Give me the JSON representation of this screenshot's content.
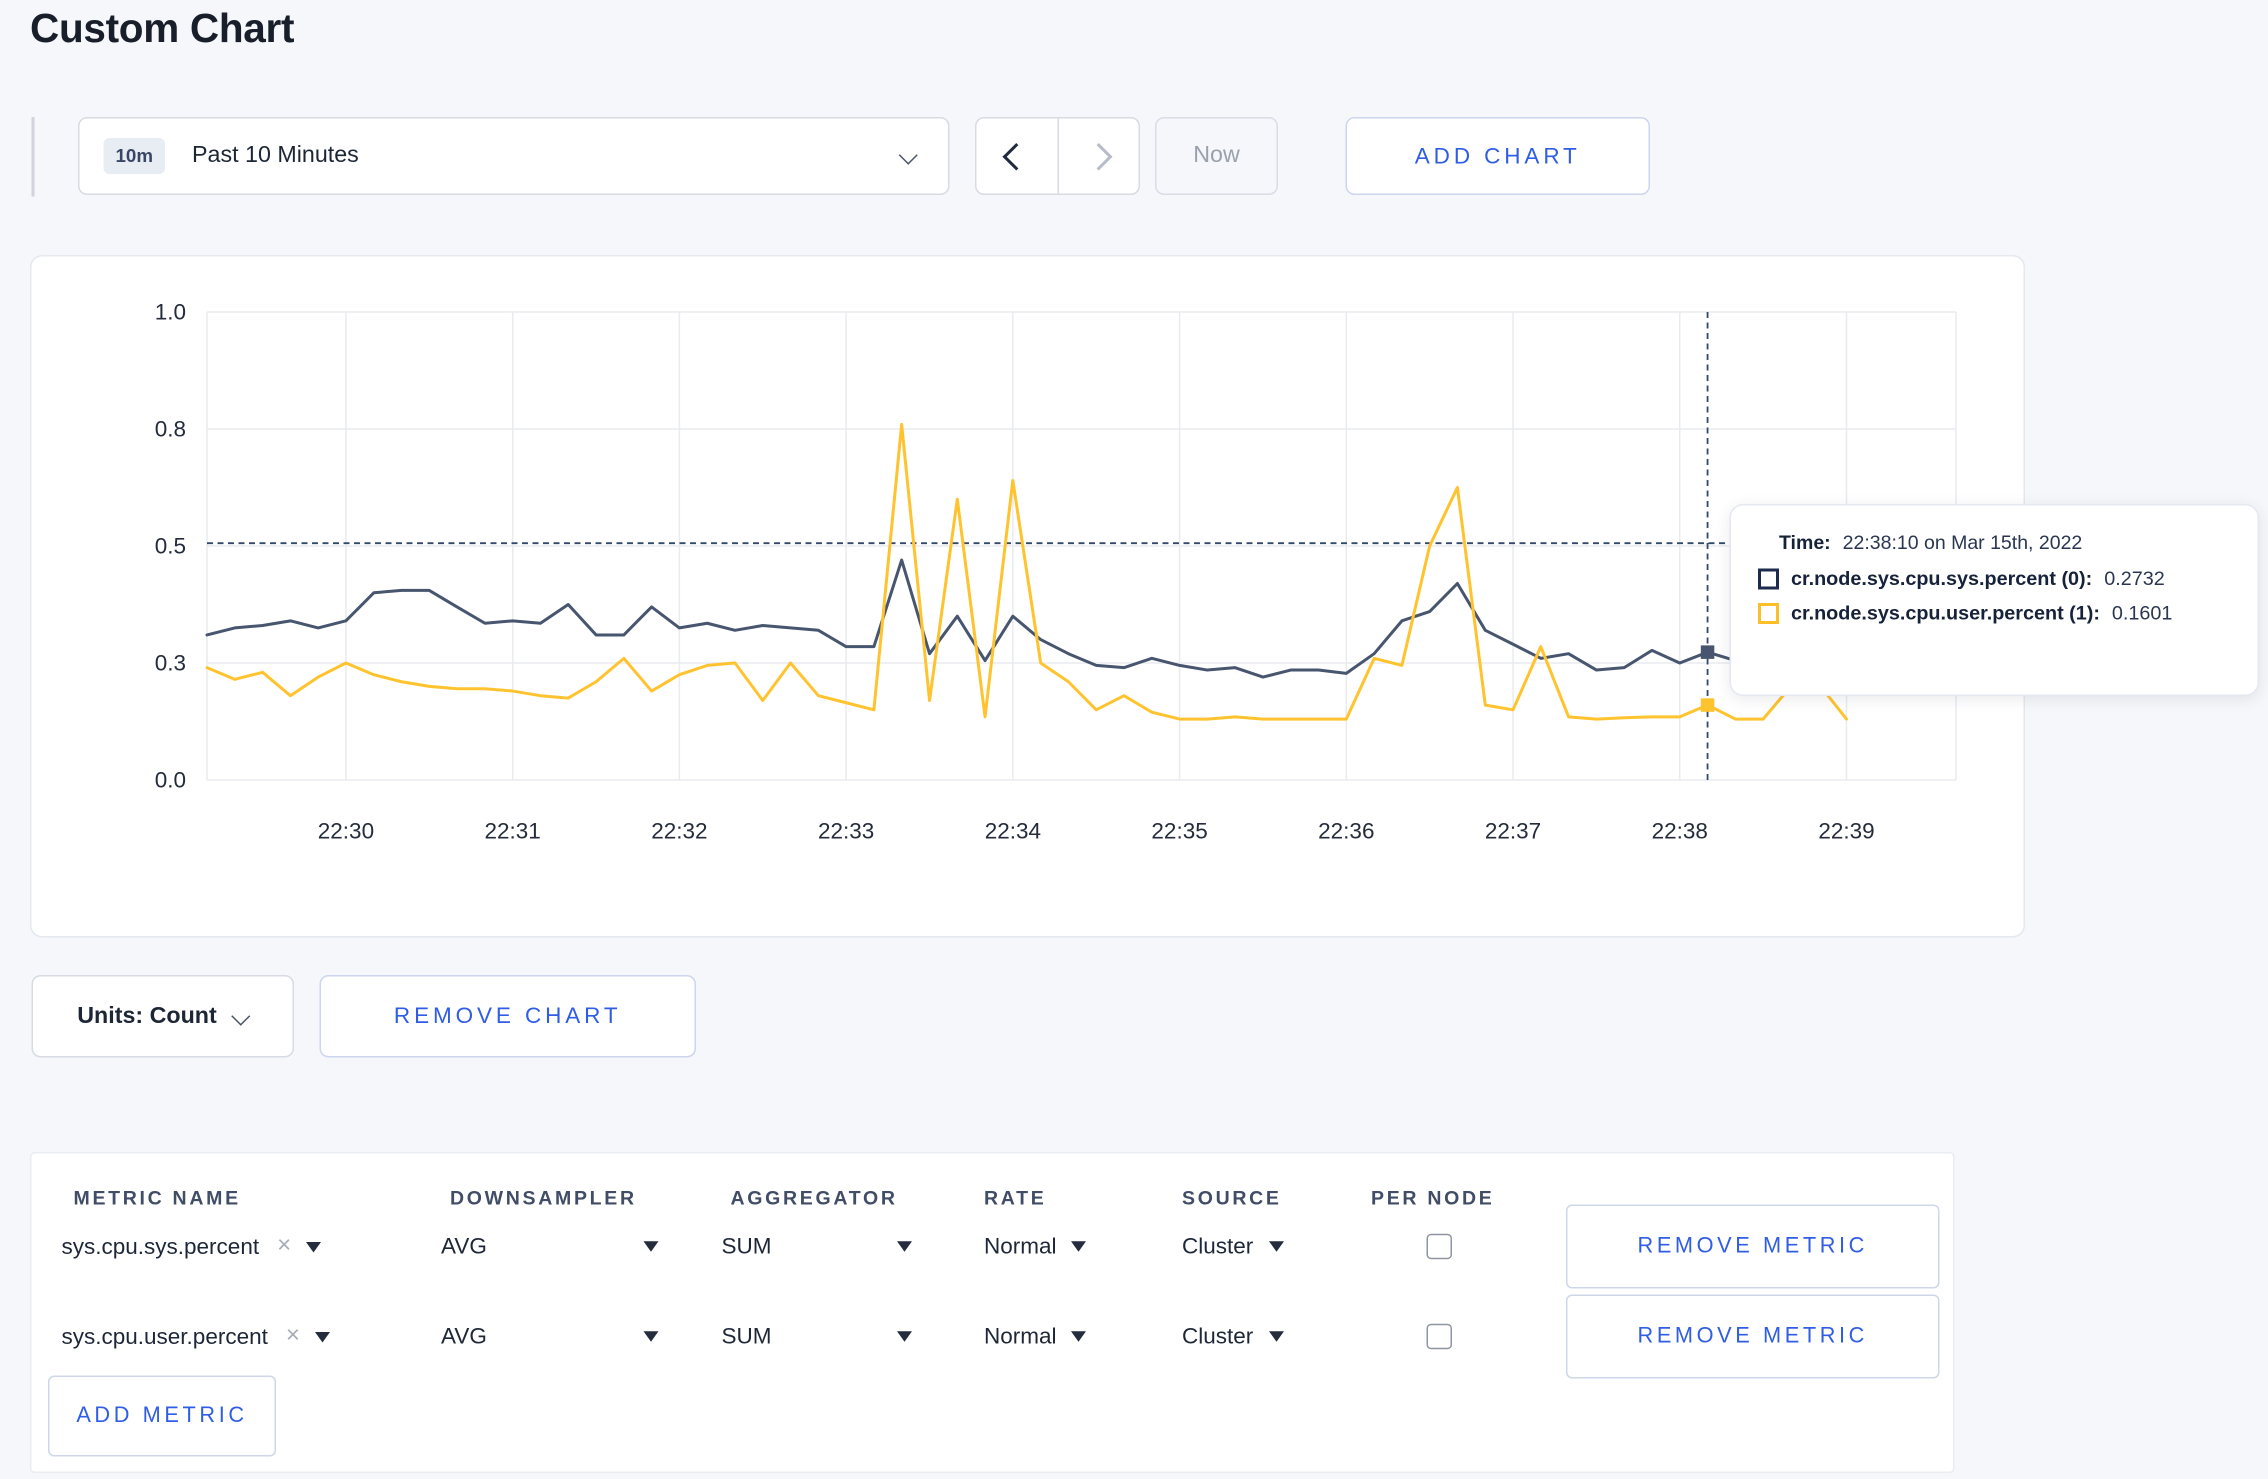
{
  "page": {
    "title": "Custom Chart"
  },
  "toolbar": {
    "time_range_badge": "10m",
    "time_range_label": "Past 10 Minutes",
    "now_label": "Now",
    "add_chart_label": "ADD CHART"
  },
  "chart_data": {
    "type": "line",
    "title": "",
    "xlabel": "",
    "ylabel": "",
    "ylim": [
      0,
      1
    ],
    "grid": true,
    "x_start": "22:29:10",
    "x_end": "22:39:00",
    "interval_seconds": 10,
    "x_ticks": [
      "22:30",
      "22:31",
      "22:32",
      "22:33",
      "22:34",
      "22:35",
      "22:36",
      "22:37",
      "22:38",
      "22:39"
    ],
    "y_ticks": [
      {
        "v": 0.0,
        "label": "0.0"
      },
      {
        "v": 0.25,
        "label": "0.3"
      },
      {
        "v": 0.5,
        "label": "0.5"
      },
      {
        "v": 0.75,
        "label": "0.8"
      },
      {
        "v": 1.0,
        "label": "1.0"
      }
    ],
    "series": [
      {
        "name": "cr.node.sys.cpu.sys.percent",
        "color": "#47556f",
        "values": [
          0.31,
          0.325,
          0.33,
          0.34,
          0.325,
          0.34,
          0.4,
          0.405,
          0.405,
          0.37,
          0.335,
          0.34,
          0.335,
          0.375,
          0.31,
          0.31,
          0.37,
          0.325,
          0.335,
          0.32,
          0.33,
          0.325,
          0.32,
          0.285,
          0.285,
          0.47,
          0.27,
          0.35,
          0.255,
          0.35,
          0.3,
          0.27,
          0.245,
          0.24,
          0.26,
          0.245,
          0.235,
          0.24,
          0.22,
          0.235,
          0.235,
          0.228,
          0.27,
          0.34,
          0.36,
          0.42,
          0.32,
          0.29,
          0.26,
          0.27,
          0.235,
          0.24,
          0.277,
          0.25,
          0.2732,
          0.255,
          0.26,
          0.26,
          0.255,
          0.26
        ]
      },
      {
        "name": "cr.node.sys.cpu.user.percent",
        "color": "#ffc32f",
        "values": [
          0.24,
          0.215,
          0.23,
          0.18,
          0.22,
          0.25,
          0.225,
          0.21,
          0.2,
          0.195,
          0.195,
          0.19,
          0.18,
          0.175,
          0.21,
          0.26,
          0.19,
          0.225,
          0.245,
          0.25,
          0.17,
          0.25,
          0.18,
          0.165,
          0.15,
          0.76,
          0.17,
          0.6,
          0.135,
          0.64,
          0.25,
          0.21,
          0.15,
          0.18,
          0.145,
          0.13,
          0.13,
          0.135,
          0.13,
          0.13,
          0.13,
          0.13,
          0.26,
          0.245,
          0.5,
          0.625,
          0.16,
          0.15,
          0.285,
          0.135,
          0.13,
          0.133,
          0.135,
          0.135,
          0.1601,
          0.13,
          0.13,
          0.2,
          0.205,
          0.13
        ]
      }
    ],
    "crosshair": {
      "time": "22:38:10",
      "index": 54,
      "y_value": 0.506
    }
  },
  "tooltip": {
    "time_label": "Time:",
    "time_value": "22:38:10 on Mar 15th, 2022",
    "series": [
      {
        "label": "cr.node.sys.cpu.sys.percent (0):",
        "value": "0.2732",
        "color": "#1d2c4e"
      },
      {
        "label": "cr.node.sys.cpu.user.percent (1):",
        "value": "0.1601",
        "color": "#fcbf27"
      }
    ]
  },
  "chart_controls": {
    "units_label": "Units: Count",
    "remove_chart_label": "REMOVE CHART"
  },
  "metrics_table": {
    "headers": [
      "METRIC NAME",
      "DOWNSAMPLER",
      "AGGREGATOR",
      "RATE",
      "SOURCE",
      "PER NODE"
    ],
    "rows": [
      {
        "metric_name": "sys.cpu.sys.percent",
        "downsampler": "AVG",
        "aggregator": "SUM",
        "rate": "Normal",
        "source": "Cluster",
        "per_node_checked": false,
        "remove_label": "REMOVE METRIC"
      },
      {
        "metric_name": "sys.cpu.user.percent",
        "downsampler": "AVG",
        "aggregator": "SUM",
        "rate": "Normal",
        "source": "Cluster",
        "per_node_checked": false,
        "remove_label": "REMOVE METRIC"
      }
    ],
    "add_metric_label": "ADD METRIC"
  },
  "colors": {
    "accent_blue": "#2f5de6",
    "page_bg": "#f5f7fa"
  }
}
